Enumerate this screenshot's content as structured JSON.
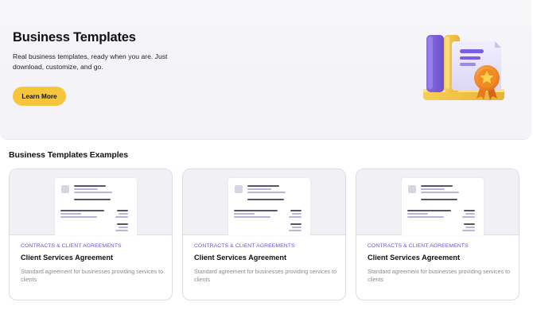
{
  "hero": {
    "title": "Business Templates",
    "description": "Real business templates, ready when you are. Just download, customize, and go.",
    "cta_label": "Learn More",
    "illustration_icon": "document-with-award-ribbon-icon"
  },
  "examples": {
    "title": "Business Templates Examples",
    "cards": [
      {
        "category": "CONTRACTS & CLIENT AGREEMENTS",
        "title": "Client Services Agreement",
        "description": "Standard agreement for businesses providing services to clients"
      },
      {
        "category": "CONTRACTS & CLIENT AGREEMENTS",
        "title": "Client Services Agreement",
        "description": "Standard agreement for businesses providing services to clients"
      },
      {
        "category": "CONTRACTS & CLIENT AGREEMENTS",
        "title": "Client Services Agreement",
        "description": "Standard agreement for businesses providing services to clients"
      }
    ]
  },
  "colors": {
    "accent_yellow": "#f5c53b",
    "category_purple": "#6f4fd8",
    "hero_background": "#f5f5f9"
  }
}
